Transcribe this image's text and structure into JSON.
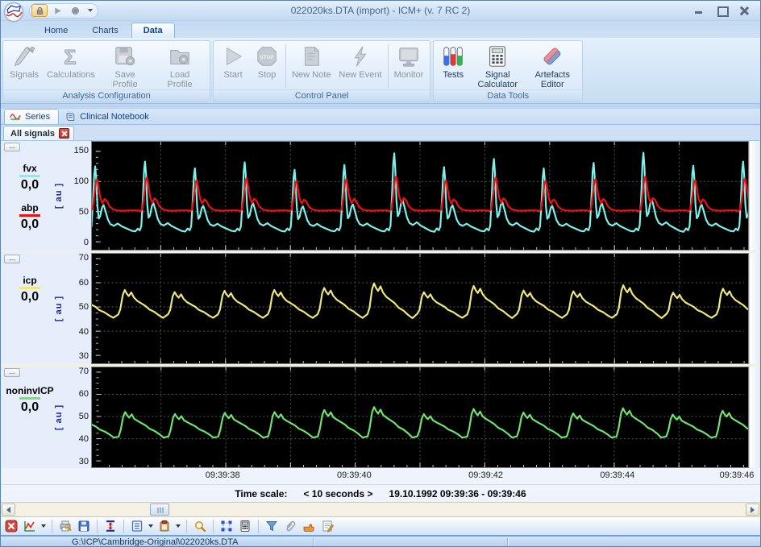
{
  "window": {
    "title": "022020ks.DTA (import)  - ICM+ (v. 7 RC 2)"
  },
  "misc": {
    "ellipsis": "...",
    "au_unit": "[ au ]"
  },
  "icon_texts": {
    "sigma": "Σ",
    "stop": "STOP"
  },
  "ribbon": {
    "tabs": [
      {
        "label": "Home",
        "active": false
      },
      {
        "label": "Charts",
        "active": false
      },
      {
        "label": "Data",
        "active": true
      }
    ],
    "groups": [
      {
        "title": "Analysis Configuration",
        "buttons": [
          {
            "label": "Signals",
            "icon": "probe-icon",
            "enabled": false
          },
          {
            "label": "Calculations",
            "icon": "sigma-icon",
            "enabled": false
          },
          {
            "label": "Save Profile",
            "icon": "save-profile-icon",
            "enabled": false
          },
          {
            "label": "Load Profile",
            "icon": "load-profile-icon",
            "enabled": false
          }
        ]
      },
      {
        "title": "Control Panel",
        "buttons": [
          {
            "label": "Start",
            "icon": "play-icon",
            "enabled": false
          },
          {
            "label": "Stop",
            "icon": "stop-sign-icon",
            "enabled": false,
            "sep_after": true
          },
          {
            "label": "New Note",
            "icon": "note-icon",
            "enabled": false
          },
          {
            "label": "New Event",
            "icon": "lightning-icon",
            "enabled": false,
            "sep_after": true
          },
          {
            "label": "Monitor",
            "icon": "monitor-icon",
            "enabled": false
          }
        ]
      },
      {
        "title": "Data Tools",
        "buttons": [
          {
            "label": "Tests",
            "icon": "test-tubes-icon",
            "enabled": true
          },
          {
            "label": "Signal Calculator",
            "icon": "calculator-icon",
            "enabled": true
          },
          {
            "label": "Artefacts Editor",
            "icon": "eraser-icon",
            "enabled": true
          }
        ]
      }
    ]
  },
  "view_tabs": [
    {
      "label": "Series",
      "icon": "wave-icon",
      "active": true
    },
    {
      "label": "Clinical Notebook",
      "icon": "notebook-icon",
      "active": false
    }
  ],
  "signal_tabs": [
    {
      "label": "All signals",
      "closable": true,
      "active": true
    }
  ],
  "time_axis": {
    "ticks": [
      {
        "s": 2,
        "label": "09:39:38"
      },
      {
        "s": 4,
        "label": "09:39:40"
      },
      {
        "s": 6,
        "label": "09:39:42"
      },
      {
        "s": 8,
        "label": "09:39:44"
      },
      {
        "s": 10,
        "label": "09:39:46"
      }
    ]
  },
  "time_scale": {
    "label": "Time scale:",
    "selector": "<  10 seconds  >",
    "range": "19.10.1992 09:39:36 - 09:39:46"
  },
  "toolbar": {
    "buttons": [
      {
        "icon": "close-red-icon"
      },
      {
        "icon": "chart-line-icon",
        "caret": true,
        "sep_after": true
      },
      {
        "icon": "print-icon"
      },
      {
        "icon": "save-icon",
        "sep_after": true
      },
      {
        "icon": "vertical-scale-icon",
        "sep_after": true
      },
      {
        "icon": "list-icon",
        "caret": true
      },
      {
        "icon": "clipboard-icon",
        "caret": true,
        "sep_after": true
      },
      {
        "icon": "magnifier-icon",
        "sep_after": true
      },
      {
        "icon": "selection-icon"
      },
      {
        "icon": "calculator-small-icon",
        "sep_after": true
      },
      {
        "icon": "filter-icon"
      },
      {
        "icon": "paperclip-icon"
      },
      {
        "icon": "hand-icon"
      },
      {
        "icon": "notes-icon"
      }
    ]
  },
  "status_bar": {
    "file_path": "G:\\ICP\\Cambridge-Original\\022020ks.DTA"
  },
  "chart_data": [
    {
      "type": "line",
      "plot_bg": "#000000",
      "ylabel": "[ au ]",
      "ylim": [
        0,
        150
      ],
      "yticks": [
        150,
        100,
        50,
        0
      ],
      "ytick_minor": 10,
      "xlim_s": [
        0,
        10
      ],
      "x_window": {
        "start": "09:39:36",
        "end": "09:39:46",
        "duration_s": 10
      },
      "grid": true,
      "series": [
        {
          "name": "fvx",
          "display_value": "0,0",
          "color": "#7df2ec",
          "unit": "au",
          "base": 20,
          "period_s": 0.769,
          "phase_offset": 0.16,
          "cycle_template": [
            [
              0,
              22
            ],
            [
              0.04,
              19
            ],
            [
              0.07,
              26
            ],
            [
              0.1,
              70
            ],
            [
              0.125,
              118
            ],
            [
              0.145,
              133
            ],
            [
              0.165,
              112
            ],
            [
              0.19,
              62
            ],
            [
              0.215,
              40
            ],
            [
              0.245,
              44
            ],
            [
              0.285,
              60
            ],
            [
              0.315,
              64
            ],
            [
              0.35,
              54
            ],
            [
              0.4,
              38
            ],
            [
              0.45,
              30
            ],
            [
              0.52,
              27
            ],
            [
              0.6,
              31
            ],
            [
              0.68,
              26
            ],
            [
              0.78,
              22
            ],
            [
              0.88,
              18
            ],
            [
              0.95,
              17
            ],
            [
              1,
              22
            ]
          ],
          "peak_scale": [
            0.93,
            1.0,
            0.9,
            0.99,
            0.88,
            0.95,
            1.12,
            0.92,
            1.04,
            0.9,
            0.98,
            1.13,
            0.94,
            1.0,
            0.9
          ]
        },
        {
          "name": "abp",
          "display_value": "0,0",
          "color": "#ee1111",
          "unit": "au",
          "base": 52,
          "period_s": 0.769,
          "phase_offset": 0.16,
          "cycle_template": [
            [
              0,
              52
            ],
            [
              0.05,
              51
            ],
            [
              0.09,
              54
            ],
            [
              0.13,
              78
            ],
            [
              0.16,
              100
            ],
            [
              0.185,
              104
            ],
            [
              0.21,
              92
            ],
            [
              0.25,
              72
            ],
            [
              0.29,
              64
            ],
            [
              0.335,
              71
            ],
            [
              0.38,
              68
            ],
            [
              0.43,
              59
            ],
            [
              0.5,
              54
            ],
            [
              0.58,
              52
            ],
            [
              0.7,
              51.5
            ],
            [
              0.85,
              52
            ],
            [
              1,
              52
            ]
          ],
          "peak_scale": [
            1.0,
            1.05,
            0.97,
            1.03,
            0.95,
            1.0,
            1.08,
            0.96,
            1.05,
            0.95,
            1.0,
            1.08,
            0.97,
            1.02,
            0.95
          ]
        }
      ]
    },
    {
      "type": "line",
      "plot_bg": "#000000",
      "ylabel": "[ au ]",
      "ylim": [
        30,
        70
      ],
      "yticks": [
        70,
        60,
        50,
        40,
        30
      ],
      "ytick_minor": 2.5,
      "xlim_s": [
        0,
        10
      ],
      "x_window": {
        "start": "09:39:36",
        "end": "09:39:46",
        "duration_s": 10
      },
      "grid": true,
      "series": [
        {
          "name": "icp",
          "display_value": "0,0",
          "color": "#f0e87a",
          "unit": "au",
          "base": 46,
          "period_s": 0.769,
          "phase_offset": 0.55,
          "cycle_template": [
            [
              0,
              47
            ],
            [
              0.04,
              49
            ],
            [
              0.09,
              55
            ],
            [
              0.13,
              57
            ],
            [
              0.17,
              55.5
            ],
            [
              0.21,
              54.5
            ],
            [
              0.26,
              56
            ],
            [
              0.31,
              54
            ],
            [
              0.38,
              52.5
            ],
            [
              0.46,
              51.5
            ],
            [
              0.54,
              50.5
            ],
            [
              0.62,
              49
            ],
            [
              0.72,
              48
            ],
            [
              0.82,
              46.5
            ],
            [
              0.9,
              45.5
            ],
            [
              1,
              47
            ]
          ],
          "peak_scale": [
            0.9,
            1.0,
            0.92,
            0.97,
            1.0,
            1.08,
            1.25,
            0.92,
            1.15,
            0.98,
            0.95,
            1.18,
            0.9,
            1.05,
            0.95
          ]
        }
      ]
    },
    {
      "type": "line",
      "plot_bg": "#000000",
      "ylabel": "[ au ]",
      "ylim": [
        30,
        70
      ],
      "yticks": [
        70,
        60,
        50,
        40,
        30
      ],
      "ytick_minor": 2.5,
      "xlim_s": [
        0,
        10
      ],
      "x_window": {
        "start": "09:39:36",
        "end": "09:39:46",
        "duration_s": 10
      },
      "grid": true,
      "series": [
        {
          "name": "noninvICP",
          "display_value": "0,0",
          "color": "#6fe46f",
          "unit": "au",
          "base": 40.5,
          "period_s": 0.769,
          "phase_offset": 0.55,
          "cycle_template": [
            [
              0,
              41
            ],
            [
              0.04,
              44
            ],
            [
              0.09,
              50
            ],
            [
              0.13,
              52
            ],
            [
              0.17,
              50.5
            ],
            [
              0.21,
              49.5
            ],
            [
              0.26,
              51
            ],
            [
              0.31,
              49
            ],
            [
              0.38,
              48
            ],
            [
              0.46,
              47
            ],
            [
              0.54,
              46
            ],
            [
              0.62,
              44.5
            ],
            [
              0.72,
              43.5
            ],
            [
              0.82,
              42
            ],
            [
              0.9,
              40.5
            ],
            [
              1,
              41
            ]
          ],
          "peak_scale": [
            0.9,
            1.0,
            0.92,
            0.97,
            1.0,
            1.08,
            1.2,
            0.92,
            1.12,
            0.98,
            0.95,
            1.15,
            0.9,
            1.05,
            0.95
          ]
        }
      ]
    }
  ]
}
